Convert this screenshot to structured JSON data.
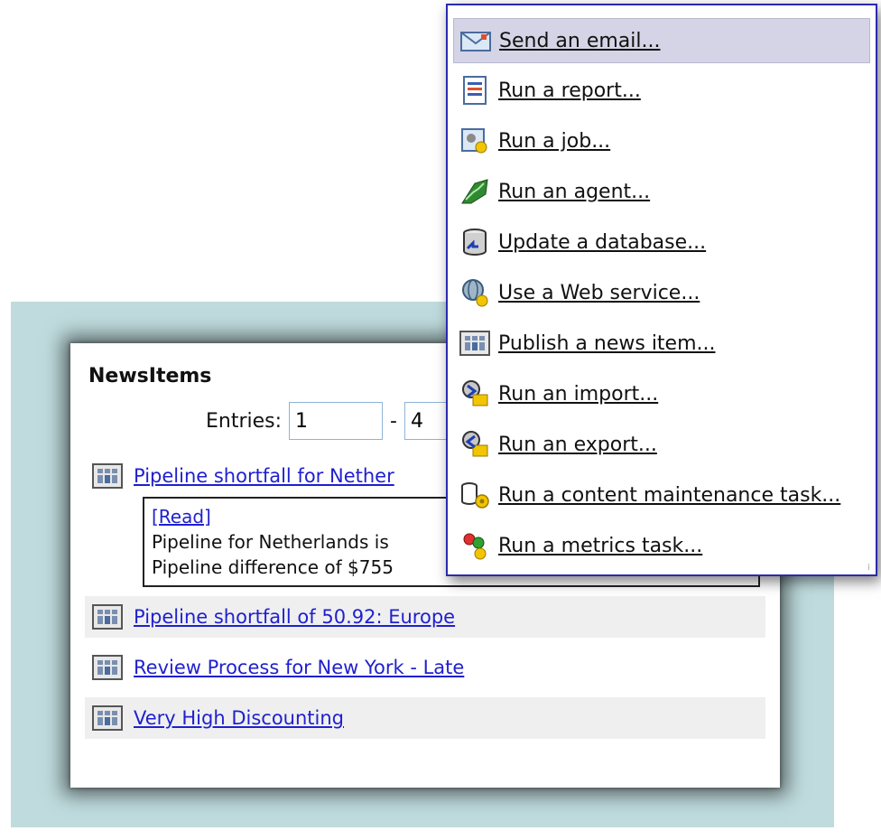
{
  "panel": {
    "title": "NewsItems",
    "entries_label": "Entries:",
    "entries_from": "1",
    "entries_sep": "-",
    "entries_to": "4"
  },
  "news": {
    "items": [
      {
        "label": "Pipeline shortfall for Nether"
      },
      {
        "label": "Pipeline shortfall of 50.92: Europe"
      },
      {
        "label": "Review Process for New York - Late"
      },
      {
        "label": "Very High Discounting"
      }
    ],
    "detail": {
      "read_link": "[Read]",
      "line1": "Pipeline for Netherlands is",
      "line2": "Pipeline difference of $755"
    }
  },
  "menu": {
    "items": [
      {
        "label": "Send an email...",
        "icon": "email-icon"
      },
      {
        "label": "Run a report...",
        "icon": "report-icon"
      },
      {
        "label": "Run a job...",
        "icon": "job-icon"
      },
      {
        "label": "Run an agent...",
        "icon": "agent-icon"
      },
      {
        "label": "Update a database...",
        "icon": "database-icon"
      },
      {
        "label": "Use a Web service...",
        "icon": "web-service-icon"
      },
      {
        "label": "Publish a news item...",
        "icon": "news-icon"
      },
      {
        "label": "Run an import...",
        "icon": "import-icon"
      },
      {
        "label": "Run an export...",
        "icon": "export-icon"
      },
      {
        "label": "Run a content maintenance task...",
        "icon": "maintenance-icon"
      },
      {
        "label": "Run a metrics task...",
        "icon": "metrics-icon"
      }
    ]
  },
  "colors": {
    "link": "#1f1fd0",
    "menu_border": "#2a2ab0",
    "highlight": "#d4d4e6",
    "backdrop": "#bfdbdd"
  }
}
